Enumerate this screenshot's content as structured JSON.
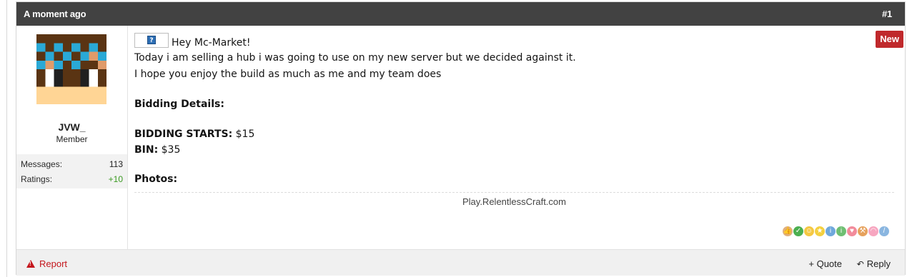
{
  "post": {
    "time": "A moment ago",
    "number": "#1",
    "badge": "New"
  },
  "user": {
    "name": "JVW_",
    "title": "Member",
    "stats": [
      {
        "label": "Messages:",
        "value": "113"
      },
      {
        "label": "Ratings:",
        "value": "+10"
      }
    ]
  },
  "message": {
    "greeting": "Hey Mc-Market!",
    "line1": "Today i am selling a hub i was going to use on my new server but we decided against it.",
    "line2": "I hope you enjoy the build as much as me and my team does",
    "bidding_details": "Bidding Details:",
    "starts_label": "BIDDING STARTS:",
    "starts_value": " $15",
    "bin_label": "BIN:",
    "bin_value": " $35",
    "photos": "Photos:"
  },
  "signature": "Play.RelentlessCraft.com",
  "footer": {
    "report": "Report",
    "quote": "+ Quote",
    "reply": "Reply"
  },
  "rating_icons": [
    "thumbs-up-icon",
    "check-icon",
    "smile-icon",
    "star-icon",
    "info-icon",
    "info-icon",
    "heart-icon",
    "wrench-icon",
    "rainbow-icon",
    "brush-icon"
  ]
}
